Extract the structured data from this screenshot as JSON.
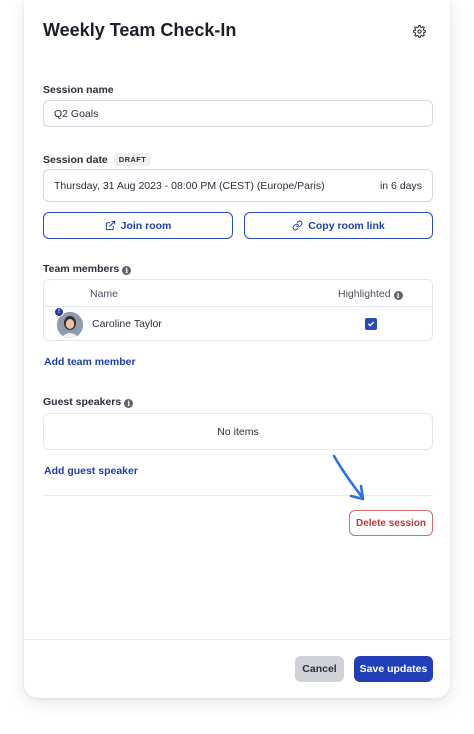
{
  "dialog": {
    "title": "Weekly Team Check-In",
    "settings_icon": "gear-icon"
  },
  "session_name": {
    "label": "Session name",
    "value": "Q2 Goals"
  },
  "session_date": {
    "label": "Session date",
    "badge": "DRAFT",
    "value": "Thursday, 31 Aug 2023 - 08:00 PM (CEST) (Europe/Paris)",
    "relative": "in 6 days"
  },
  "actions": {
    "join_room": "Join room",
    "copy_room_link": "Copy room link"
  },
  "team_members": {
    "label": "Team members",
    "columns": [
      "Name",
      "Highlighted"
    ],
    "rows": [
      {
        "name": "Caroline Taylor",
        "highlighted": true,
        "badge": "!"
      }
    ],
    "add_label": "Add team member"
  },
  "guest_speakers": {
    "label": "Guest speakers",
    "empty_text": "No items",
    "add_label": "Add guest speaker"
  },
  "delete_label": "Delete session",
  "footer": {
    "cancel_label": "Cancel",
    "save_label": "Save updates"
  },
  "colors": {
    "accent": "#2140b8",
    "danger": "#c23a3a",
    "arrow": "#2f6fe0"
  }
}
